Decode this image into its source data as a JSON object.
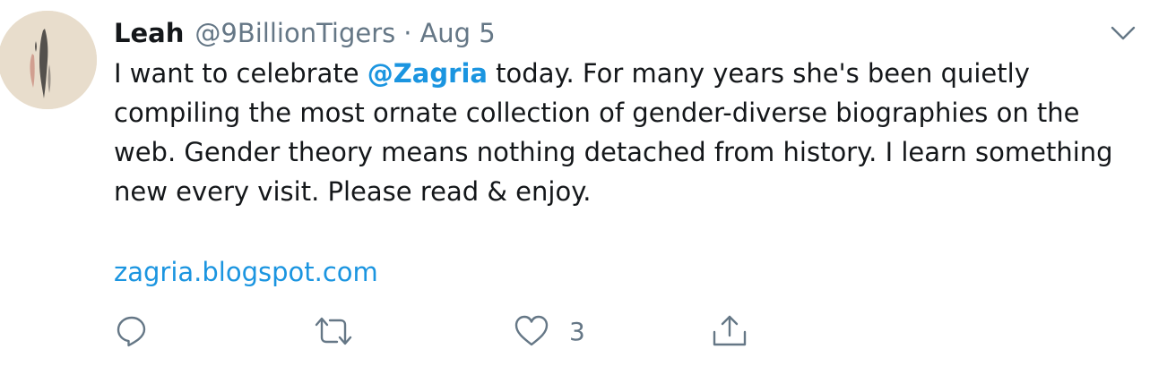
{
  "tweet": {
    "author_name": "Leah",
    "author_handle": "@9BillionTigers",
    "separator": "·",
    "date": "Aug 5",
    "text_before_mention": "I want to celebrate ",
    "mention": "@Zagria",
    "text_after_mention_line1": " today. For many years she's been quietly",
    "text_line2": "compiling the most ornate collection of gender-diverse biographies on the",
    "text_line3": "web. Gender theory means nothing detached from history. I learn something",
    "text_line4": "new every visit. Please read & enjoy.",
    "link": "zagria.blogspot.com",
    "like_count": "3"
  },
  "icons": {
    "menu": "chevron-down-icon",
    "reply": "reply-icon",
    "retweet": "retweet-icon",
    "like": "heart-icon",
    "share": "share-icon"
  },
  "colors": {
    "link": "#1b95e0",
    "secondary_text": "#657786",
    "primary_text": "#14171a"
  }
}
